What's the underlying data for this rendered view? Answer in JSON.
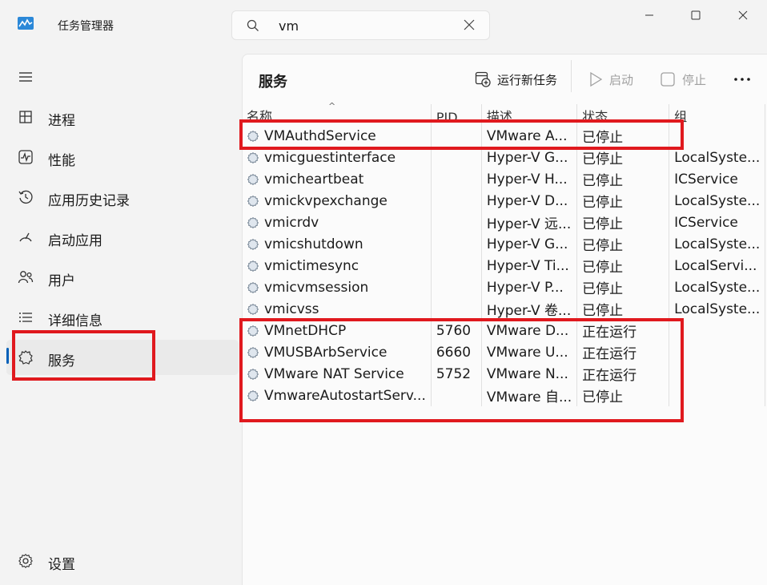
{
  "app": {
    "title": "任务管理器"
  },
  "search": {
    "value": "vm",
    "placeholder": ""
  },
  "sidebar": {
    "items": [
      {
        "label": "进程",
        "icon": "processes-icon"
      },
      {
        "label": "性能",
        "icon": "performance-icon"
      },
      {
        "label": "应用历史记录",
        "icon": "history-icon"
      },
      {
        "label": "启动应用",
        "icon": "startup-icon"
      },
      {
        "label": "用户",
        "icon": "users-icon"
      },
      {
        "label": "详细信息",
        "icon": "details-icon"
      },
      {
        "label": "服务",
        "icon": "services-icon"
      }
    ],
    "settings_label": "设置"
  },
  "main": {
    "title": "服务",
    "toolbar": {
      "run_new_task": "运行新任务",
      "start": "启动",
      "stop": "停止"
    }
  },
  "table": {
    "headers": {
      "name": "名称",
      "pid": "PID",
      "desc": "描述",
      "status": "状态",
      "group": "组"
    },
    "rows": [
      {
        "name": "VMAuthdService",
        "pid": "",
        "desc": "VMware A...",
        "status": "已停止",
        "group": ""
      },
      {
        "name": "vmicguestinterface",
        "pid": "",
        "desc": "Hyper-V G...",
        "status": "已停止",
        "group": "LocalSyste..."
      },
      {
        "name": "vmicheartbeat",
        "pid": "",
        "desc": "Hyper-V H...",
        "status": "已停止",
        "group": "ICService"
      },
      {
        "name": "vmickvpexchange",
        "pid": "",
        "desc": "Hyper-V D...",
        "status": "已停止",
        "group": "LocalSyste..."
      },
      {
        "name": "vmicrdv",
        "pid": "",
        "desc": "Hyper-V 远...",
        "status": "已停止",
        "group": "ICService"
      },
      {
        "name": "vmicshutdown",
        "pid": "",
        "desc": "Hyper-V G...",
        "status": "已停止",
        "group": "LocalSyste..."
      },
      {
        "name": "vmictimesync",
        "pid": "",
        "desc": "Hyper-V Ti...",
        "status": "已停止",
        "group": "LocalServi..."
      },
      {
        "name": "vmicvmsession",
        "pid": "",
        "desc": "Hyper-V P...",
        "status": "已停止",
        "group": "LocalSyste..."
      },
      {
        "name": "vmicvss",
        "pid": "",
        "desc": "Hyper-V 卷...",
        "status": "已停止",
        "group": "LocalSyste..."
      },
      {
        "name": "VMnetDHCP",
        "pid": "5760",
        "desc": "VMware D...",
        "status": "正在运行",
        "group": ""
      },
      {
        "name": "VMUSBArbService",
        "pid": "6660",
        "desc": "VMware U...",
        "status": "正在运行",
        "group": ""
      },
      {
        "name": "VMware NAT Service",
        "pid": "5752",
        "desc": "VMware N...",
        "status": "正在运行",
        "group": ""
      },
      {
        "name": "VmwareAutostartServ...",
        "pid": "",
        "desc": "VMware 自...",
        "status": "已停止",
        "group": ""
      }
    ]
  },
  "colors": {
    "highlight_box": "#e0191e",
    "accent": "#005fb8"
  }
}
